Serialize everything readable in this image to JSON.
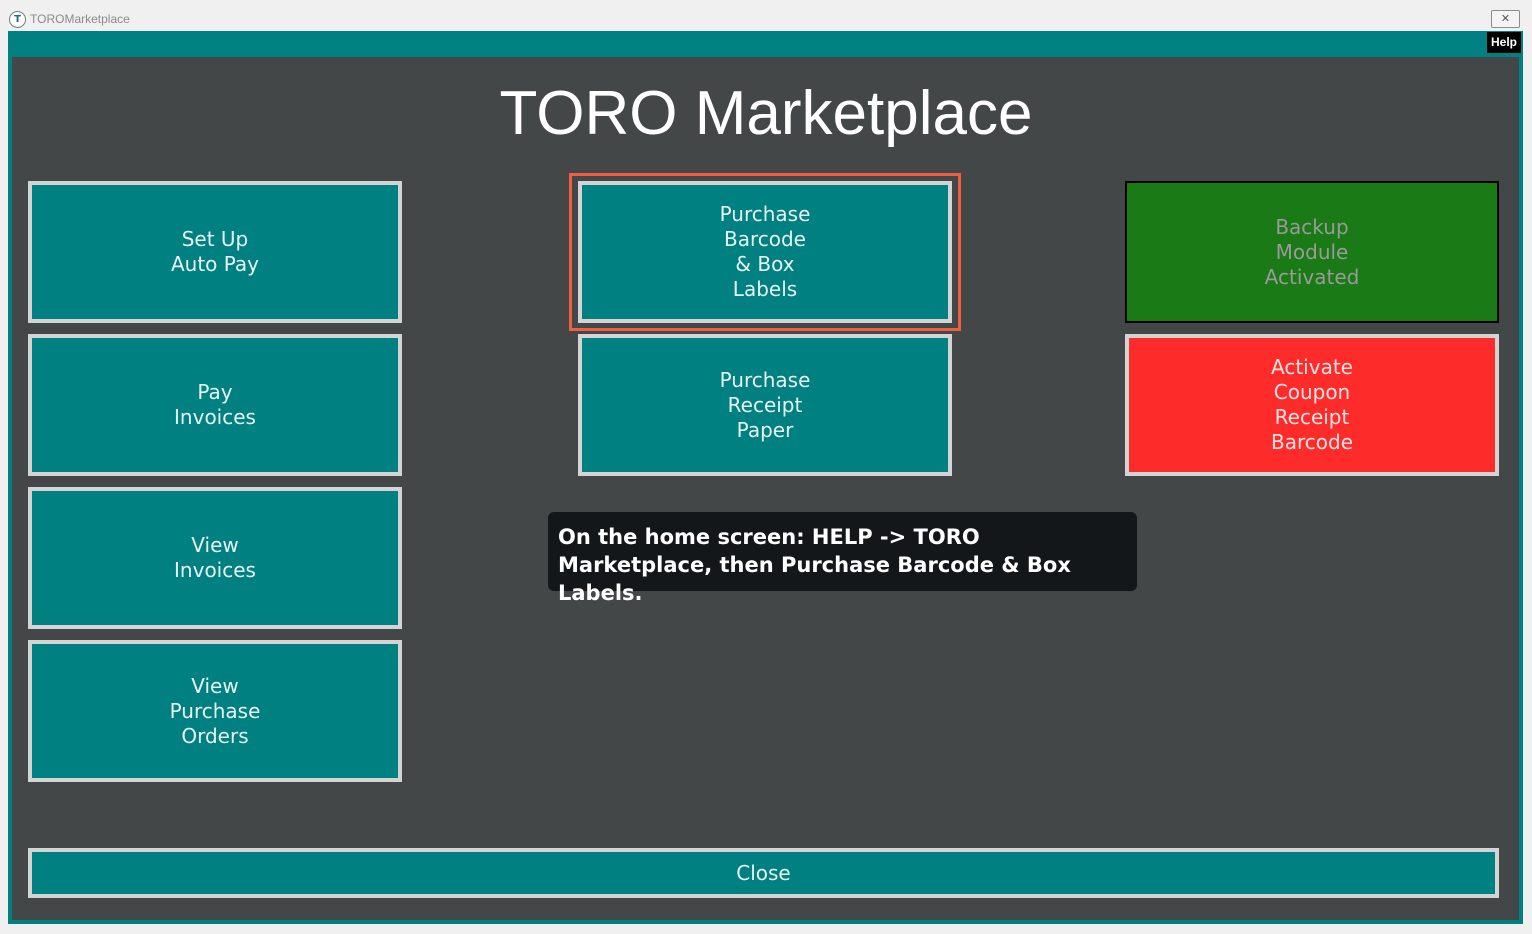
{
  "window": {
    "title": "TOROMarketplace",
    "icon_glyph": "T",
    "close_glyph": "✕",
    "help_label": "Help"
  },
  "main": {
    "title": "TORO Marketplace",
    "tiles": {
      "setup_autopay": "Set Up\nAuto Pay",
      "pay_invoices": "Pay\nInvoices",
      "view_invoices": "View\nInvoices",
      "view_po": "View\nPurchase\nOrders",
      "purchase_barcode": "Purchase\nBarcode\n& Box\nLabels",
      "purchase_receipt": "Purchase\nReceipt\nPaper",
      "backup_module": "Backup\nModule\nActivated",
      "activate_coupon": "Activate\nCoupon\nReceipt\nBarcode"
    },
    "tooltip": "On the home screen: HELP -> TORO Marketplace, then Purchase Barcode & Box Labels.",
    "close_label": "Close"
  },
  "colors": {
    "teal": "#008080",
    "panel": "#434747",
    "green": "#1a7a16",
    "red": "#fe2b2b",
    "highlight": "#f06040"
  }
}
